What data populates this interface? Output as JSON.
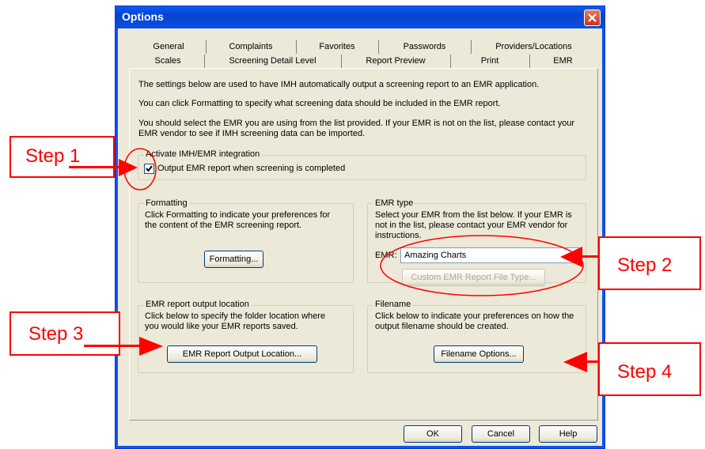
{
  "window": {
    "title": "Options"
  },
  "tabs": {
    "row1": [
      "General",
      "Complaints",
      "Favorites",
      "Passwords",
      "Providers/Locations"
    ],
    "row2": [
      "Scales",
      "Screening Detail Level",
      "Report Preview",
      "Print",
      "EMR"
    ],
    "active": "EMR"
  },
  "intro": {
    "line1": "The settings below are used to have IMH automatically output a screening report to an EMR application.",
    "line2": "You can click Formatting to specify what screening data should be included in the EMR report.",
    "line3a": "You should select the EMR you are using from the list provided. If your EMR is not on the list, please contact your",
    "line3b": "EMR vendor to see if IMH screening data can be imported."
  },
  "activate": {
    "group_title": "Activate IMH/EMR integration",
    "checkbox_label": "Output EMR report when screening is completed",
    "checked": true
  },
  "formatting": {
    "group_title": "Formatting",
    "desc1": "Click Formatting to indicate your preferences for",
    "desc2": "the content of the EMR screening report.",
    "button": "Formatting..."
  },
  "emr_type": {
    "group_title": "EMR type",
    "desc1": "Select your EMR from the list below. If your EMR is",
    "desc2": "not in the list, please contact your EMR vendor for",
    "desc3": "instructions.",
    "label": "EMR:",
    "value": "Amazing Charts",
    "custom_button": "Custom EMR Report File Type..."
  },
  "output_location": {
    "group_title": "EMR report output location",
    "desc1": "Click below to specify the folder location where",
    "desc2": "you would like your EMR reports saved.",
    "button": "EMR Report Output Location..."
  },
  "filename": {
    "group_title": "Filename",
    "desc1": "Click below to indicate your preferences on how the",
    "desc2": "output filename should be created.",
    "button": "Filename Options..."
  },
  "footer": {
    "ok": "OK",
    "cancel": "Cancel",
    "help": "Help"
  },
  "annotations": {
    "step1": "Step 1",
    "step2": "Step 2",
    "step3": "Step 3",
    "step4": "Step 4"
  },
  "colors": {
    "annotation": "#ff0000",
    "titlebar": "#0a4fe0",
    "dialog_bg": "#ece9d8"
  }
}
